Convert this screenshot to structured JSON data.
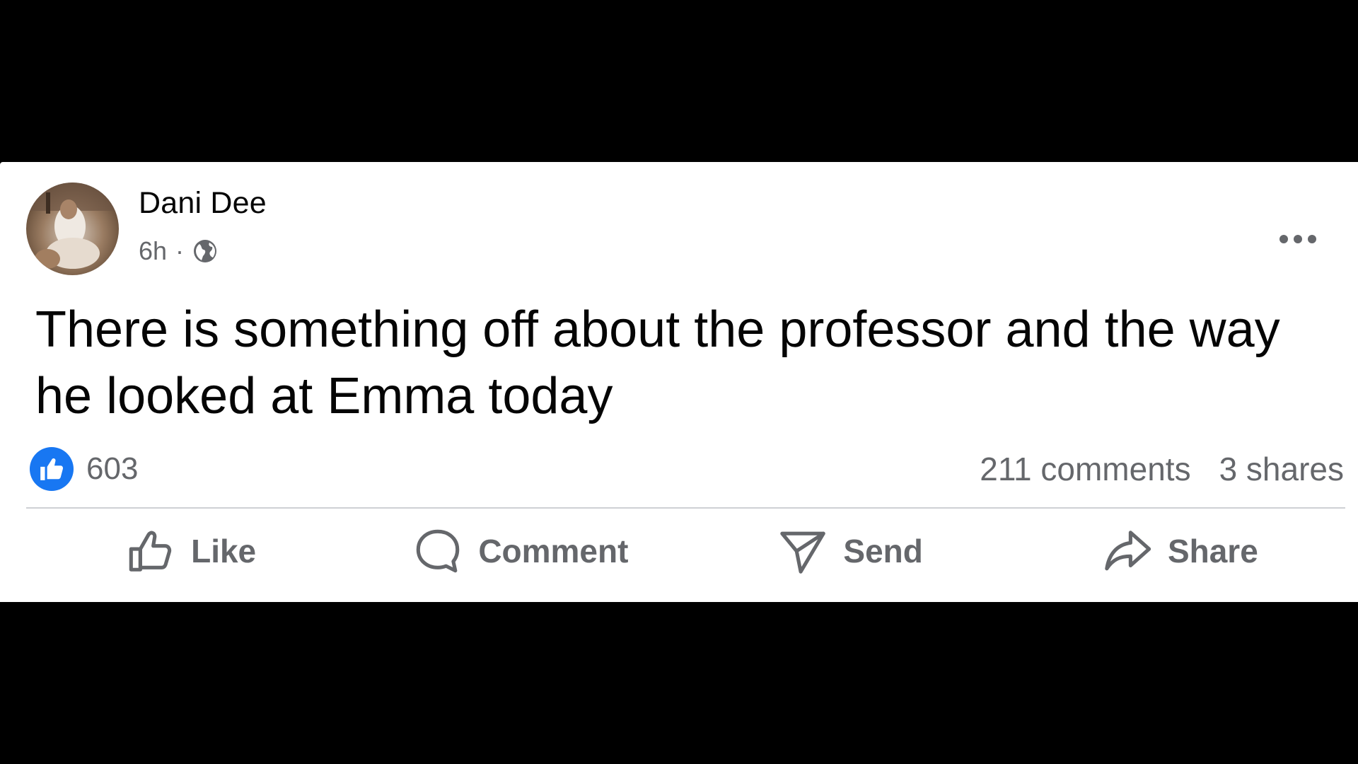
{
  "post": {
    "author": "Dani Dee",
    "time": "6h",
    "separator": "·",
    "audience_icon": "globe-icon",
    "text": "There is something off about the professor and the way he looked at Emma today",
    "reactions": {
      "icon": "like-icon",
      "count": "603"
    },
    "comments": "211 comments",
    "shares": "3 shares"
  },
  "actions": [
    {
      "label": "Like",
      "icon": "thumbs-up-icon"
    },
    {
      "label": "Comment",
      "icon": "comment-icon"
    },
    {
      "label": "Send",
      "icon": "send-icon"
    },
    {
      "label": "Share",
      "icon": "share-icon"
    }
  ],
  "colors": {
    "background": "#000000",
    "card": "#ffffff",
    "text_primary": "#050505",
    "text_secondary": "#65676b",
    "like_blue": "#1877f2",
    "divider": "#ced0d4"
  }
}
